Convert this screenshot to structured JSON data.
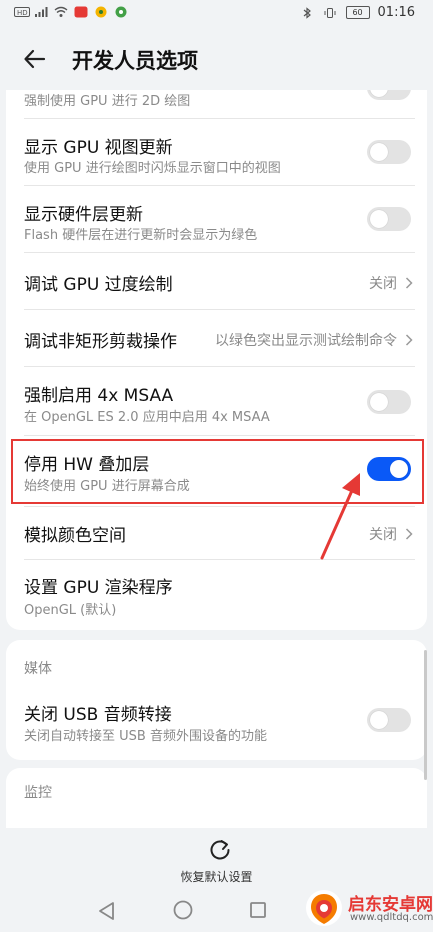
{
  "status_bar": {
    "left_icons": [
      "hd-icon",
      "signal-icon",
      "wifi-icon",
      "app-notification-icon",
      "app-notification-icon",
      "app-notification-icon"
    ],
    "battery": "60",
    "time": "01:16"
  },
  "header": {
    "title": "开发人员选项"
  },
  "settings": {
    "force_gpu_2d_sub": "强制使用 GPU 进行 2D 绘图",
    "gpu_view_updates": {
      "title": "显示 GPU 视图更新",
      "sub": "使用 GPU 进行绘图时闪烁显示窗口中的视图",
      "on": false
    },
    "hw_layers_updates": {
      "title": "显示硬件层更新",
      "sub": "Flash 硬件层在进行更新时会显示为绿色",
      "on": false
    },
    "gpu_overdraw": {
      "title": "调试 GPU 过度绘制",
      "value": "关闭"
    },
    "non_rect_clip": {
      "title": "调试非矩形剪裁操作",
      "value": "以绿色突出显示测试绘制命令"
    },
    "msaa": {
      "title": "强制启用 4x MSAA",
      "sub": "在 OpenGL ES 2.0 应用中启用 4x MSAA",
      "on": false
    },
    "disable_hw_overlays": {
      "title": "停用 HW 叠加层",
      "sub": "始终使用 GPU 进行屏幕合成",
      "on": true
    },
    "simulate_color_space": {
      "title": "模拟颜色空间",
      "value": "关闭"
    },
    "gpu_renderer": {
      "title": "设置 GPU 渲染程序",
      "sub": "OpenGL (默认)"
    }
  },
  "media": {
    "section_label": "媒体",
    "usb_audio": {
      "title": "关闭 USB 音频转接",
      "sub": "关闭自动转接至 USB 音频外围设备的功能",
      "on": false
    }
  },
  "monitoring": {
    "section_label": "监控"
  },
  "bottom": {
    "restore_label": "恢复默认设置"
  },
  "watermark": {
    "name": "启东安卓网",
    "url": "www.qdltdq.com"
  },
  "colors": {
    "accent": "#0a59f7",
    "highlight": "#e53935"
  }
}
